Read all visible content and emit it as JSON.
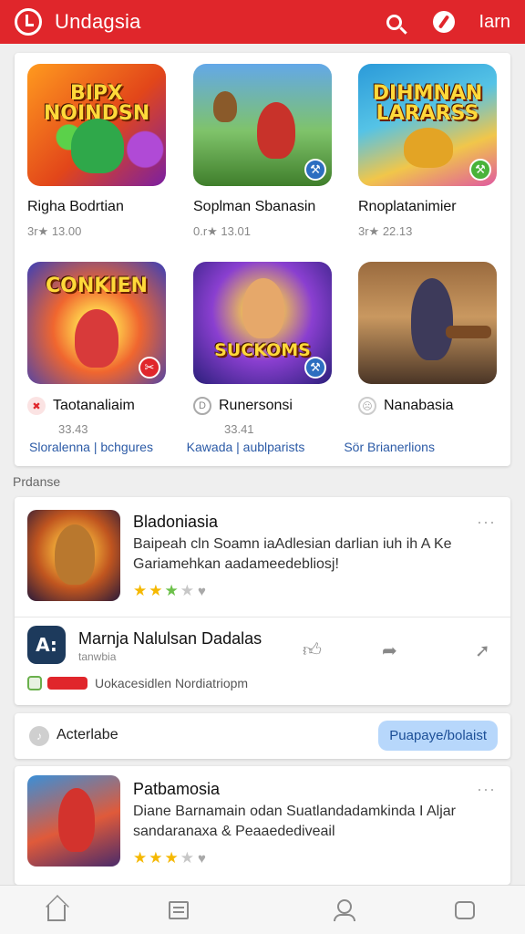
{
  "app": {
    "title": "Undagsia",
    "top_text": "Iarn",
    "icons": [
      "logo-icon",
      "search-icon",
      "compass-icon"
    ],
    "accent": "#e0262b"
  },
  "games": [
    {
      "title": "Righa Bodrtian",
      "meta": "3r★ 13.00",
      "thumb_text": "BIPX NOINDSN",
      "badge": "",
      "badge_color": ""
    },
    {
      "title": "Soplman Sbanasin",
      "meta": "0.r★ 13.01",
      "thumb_text": "",
      "badge": "⚒",
      "badge_color": "#2d6ec0"
    },
    {
      "title": "Rnoplatanimier",
      "meta": "3r★ 22.13",
      "thumb_text": "DIHMNAN LARARSS",
      "badge": "⚒",
      "badge_color": "#49b33a"
    },
    {
      "title": "Taotanaliaim",
      "meta": "33.43",
      "thumb_text": "CONKIEN",
      "badge": "✂",
      "badge_color": "#e0262b",
      "icon": "✖",
      "icon_color": "#e0262b"
    },
    {
      "title": "Runersonsi",
      "meta": "33.41",
      "thumb_text": "SUCKOMS",
      "badge": "⚒",
      "badge_color": "#2d6ec0",
      "icon": "D",
      "icon_color": "#888888"
    },
    {
      "title": "Nanabasia",
      "meta": "",
      "thumb_text": "",
      "badge": "",
      "badge_color": "",
      "icon": "☹",
      "icon_color": "#aaaaaa"
    }
  ],
  "links": [
    "Sloralenna | bchgures",
    "Kawada | aublparists",
    "Sör Brianerlions"
  ],
  "section_label": "Prdanse",
  "feed": [
    {
      "title": "Bladoniasia",
      "desc": "Baipeah cln Soamn iaAdlesian darlian iuh ih A Ke Gariamehkan aadameedebliosj!",
      "rating": 3,
      "more": "···"
    },
    {
      "title": "Patbamosia",
      "desc": "Diane Barnamain odan Suatlandadamkinda I Aljar sandaranaxa & Peaaedediveail",
      "rating": 3,
      "more": "···"
    }
  ],
  "post": {
    "avatar": "A:",
    "name": "Marnja Nalulsan Dadalas",
    "sub": "tanwbia",
    "footer": "Uokacesidlen Nordiatriopm"
  },
  "prompt": {
    "label": "Acterlabe",
    "button": "Puapaye/bolaist"
  },
  "nav": [
    "home-icon",
    "list-icon",
    "profile-icon",
    "chat-icon"
  ]
}
